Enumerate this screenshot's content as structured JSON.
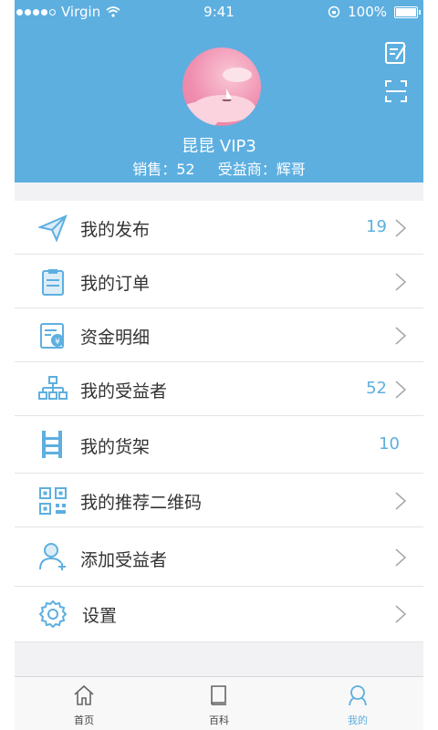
{
  "status_bar": {
    "carrier": "Virgin",
    "time": "9:41",
    "battery": "100%"
  },
  "profile": {
    "name": "昆昆 VIP3",
    "sales_label": "销售：52",
    "beneficiary_label": "受益商：辉哥"
  },
  "menu": [
    {
      "label": "我的发布",
      "value": "19",
      "icon": "paper-plane-icon"
    },
    {
      "label": "我的订单",
      "value": "",
      "icon": "clipboard-icon"
    },
    {
      "label": "资金明细",
      "value": "",
      "icon": "money-statement-icon"
    },
    {
      "label": "我的受益者",
      "value": "52",
      "icon": "org-chart-icon"
    },
    {
      "label": "我的货架",
      "value": "10",
      "icon": "shelf-icon"
    },
    {
      "label": "我的推荐二维码",
      "value": "",
      "icon": "qr-code-icon"
    },
    {
      "label": "添加受益者",
      "value": "",
      "icon": "add-user-icon"
    },
    {
      "label": "设置",
      "value": "",
      "icon": "gear-icon"
    }
  ],
  "tabs": [
    {
      "label": "首页",
      "icon": "home-icon"
    },
    {
      "label": "百科",
      "icon": "book-icon"
    },
    {
      "label": "我的",
      "icon": "profile-icon"
    }
  ],
  "colors": {
    "accent": "#5dafe0",
    "background": "#f2f2f4",
    "text": "#333333"
  }
}
